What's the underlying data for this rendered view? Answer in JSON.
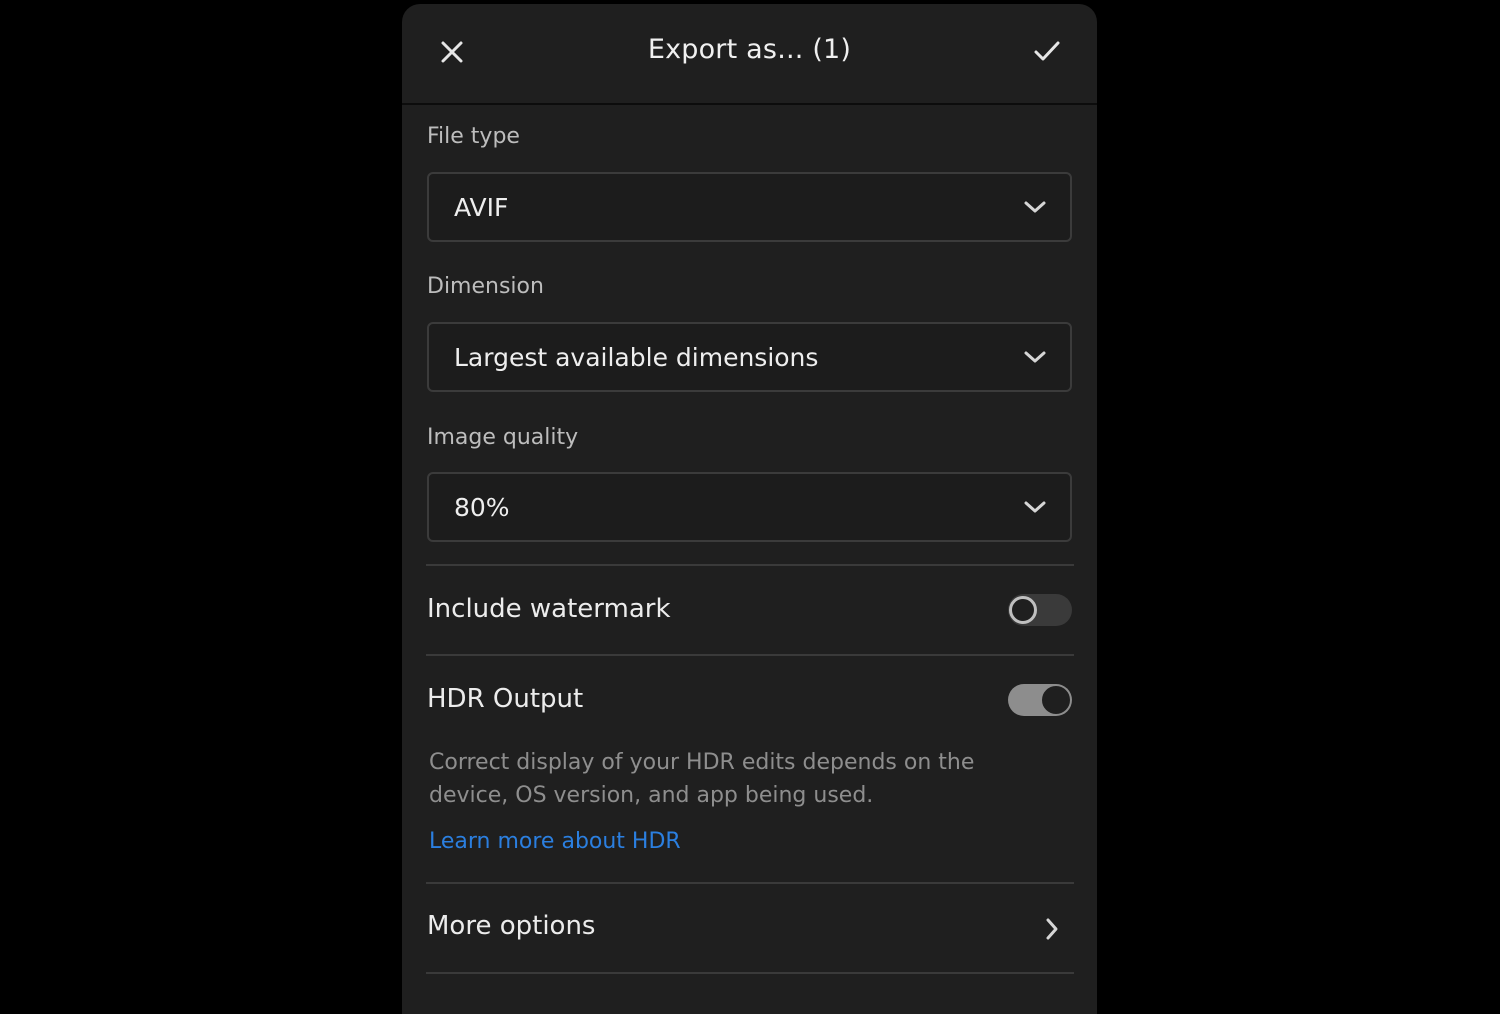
{
  "header": {
    "title": "Export as... (1)",
    "close_icon": "close-icon",
    "confirm_icon": "checkmark-icon"
  },
  "file_type": {
    "label": "File type",
    "value": "AVIF"
  },
  "dimension": {
    "label": "Dimension",
    "value": "Largest available dimensions"
  },
  "image_quality": {
    "label": "Image quality",
    "value": "80%"
  },
  "watermark": {
    "label": "Include watermark",
    "enabled": false
  },
  "hdr": {
    "label": "HDR Output",
    "enabled": true,
    "hint": "Correct display of your HDR edits depends on the device, OS version, and app being used.",
    "link": "Learn more about HDR"
  },
  "more_options": {
    "label": "More options"
  },
  "colors": {
    "background": "#000000",
    "panel": "#1f1f1f",
    "link": "#2b7fe0",
    "toggle_on": "#8d8d8d",
    "toggle_off": "#3a3a3a"
  }
}
